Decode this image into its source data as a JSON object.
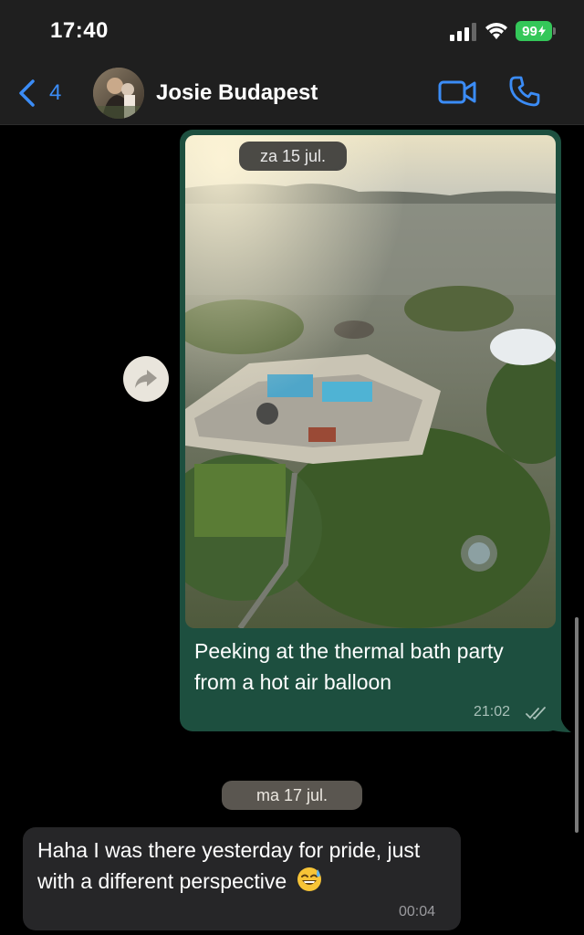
{
  "status_bar": {
    "time": "17:40",
    "battery": "99"
  },
  "header": {
    "back_count": "4",
    "contact_name": "Josie Budapest",
    "accent_color": "#3b8cf6"
  },
  "messages": [
    {
      "direction": "outgoing",
      "date_chip": "za 15 jul.",
      "has_photo": true,
      "caption": "Peeking at the thermal bath party from a hot air balloon",
      "time": "21:02",
      "status_icon": "double-check-icon",
      "bubble_color": "#1d4f3f"
    },
    {
      "direction": "incoming",
      "date_chip": "ma 17 jul.",
      "text": "Haha I was there yesterday for pride, just with a different perspective",
      "emoji": "sweat-smile-emoji",
      "time": "00:04",
      "bubble_color": "#262628"
    }
  ],
  "icons": {
    "back": "chevron-left-icon",
    "video": "video-camera-icon",
    "call": "phone-icon",
    "forward": "forward-arrow-icon"
  }
}
